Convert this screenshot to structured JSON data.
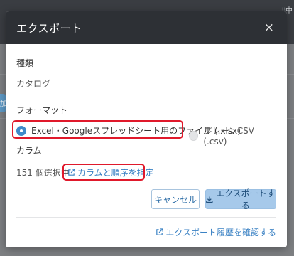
{
  "background": {
    "topbar_text": "ᴴ中",
    "left_tab_text": "加"
  },
  "modal": {
    "title": "エクスポート",
    "close_label": "×",
    "type_section": {
      "label": "種類",
      "value": "カタログ"
    },
    "format_section": {
      "label": "フォーマット",
      "options": [
        {
          "label": "Excel・Googleスプレッドシート用のファイル (.xlsx)",
          "selected": true
        },
        {
          "label": "プレーンCSV (.csv)",
          "selected": false
        }
      ]
    },
    "column_section": {
      "label": "カラム",
      "count_text": "151 個選択中",
      "link_text": "カラムと順序を指定"
    },
    "buttons": {
      "cancel": "キャンセル",
      "export": "エクスポートする"
    },
    "history_link": "エクスポート履歴を確認する"
  },
  "colors": {
    "header_bg": "#2d3035",
    "accent": "#3f8ac9",
    "link": "#3b82c4",
    "highlight": "#e0192b",
    "export_button_bg": "#a6c9ea"
  },
  "icons": {
    "external_link": "external-link-icon",
    "download": "download-icon",
    "close": "close-icon"
  }
}
